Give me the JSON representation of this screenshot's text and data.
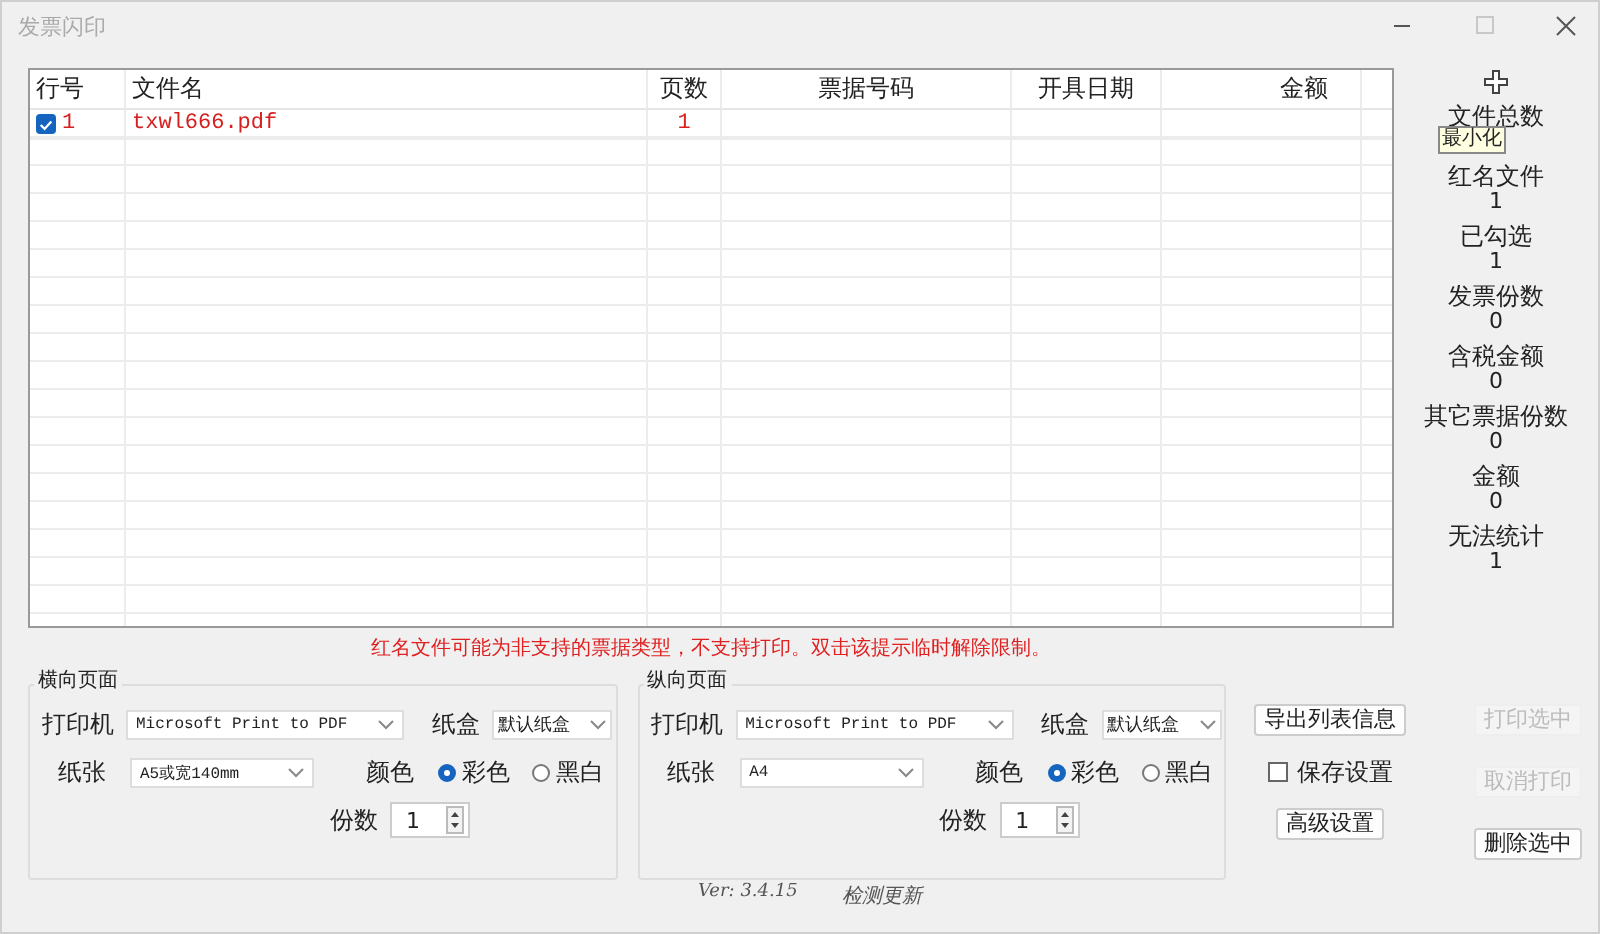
{
  "window": {
    "title": "发票闪印",
    "controls": [
      {
        "kind": "minimize",
        "disabled": false
      },
      {
        "kind": "maximize",
        "disabled": true
      },
      {
        "kind": "close",
        "disabled": false
      }
    ]
  },
  "table": {
    "columns": [
      {
        "label": "行号"
      },
      {
        "label": "文件名"
      },
      {
        "label": "页数"
      },
      {
        "label": "票据号码"
      },
      {
        "label": "开具日期"
      },
      {
        "label": "金额"
      }
    ],
    "rows": [
      {
        "checked": true,
        "flagged": true,
        "cells": [
          "1",
          "txwl666.pdf",
          "1",
          "",
          "",
          ""
        ]
      }
    ]
  },
  "stats": [
    {
      "label": "文件总数"
    },
    {
      "label": "红名文件",
      "value": "1"
    },
    {
      "label": "已勾选",
      "value": "1"
    },
    {
      "label": "发票份数",
      "value": "0"
    },
    {
      "label": "含税金额",
      "value": "0"
    },
    {
      "label": "其它票据份数",
      "value": "0"
    },
    {
      "label": "金额",
      "value": "0"
    },
    {
      "label": "无法统计",
      "value": "1"
    }
  ],
  "tooltip": "最小化",
  "warning": "红名文件可能为非支持的票据类型，不支持打印。双击该提示临时解除限制。",
  "panels": [
    {
      "title": "横向页面",
      "printer_label": "打印机",
      "printer": "Microsoft Print to PDF",
      "tray_label": "纸盒",
      "tray": "默认纸盒",
      "paper_label": "纸张",
      "paper": "A5或宽140mm",
      "color_label": "颜色",
      "color_options": [
        {
          "label": "彩色",
          "selected": true
        },
        {
          "label": "黑白",
          "selected": false
        }
      ],
      "copies_label": "份数",
      "copies": "1"
    },
    {
      "title": "纵向页面",
      "printer_label": "打印机",
      "printer": "Microsoft Print to PDF",
      "tray_label": "纸盒",
      "tray": "默认纸盒",
      "paper_label": "纸张",
      "paper": "A4",
      "color_label": "颜色",
      "color_options": [
        {
          "label": "彩色",
          "selected": true
        },
        {
          "label": "黑白",
          "selected": false
        }
      ],
      "copies_label": "份数",
      "copies": "1"
    }
  ],
  "actions": {
    "export": {
      "label": "导出列表信息",
      "disabled": false
    },
    "save_settings": {
      "label": "保存设置",
      "checked": false
    },
    "advanced": {
      "label": "高级设置",
      "disabled": false
    },
    "print_selected": {
      "label": "打印选中",
      "disabled": true
    },
    "cancel_print": {
      "label": "取消打印",
      "disabled": true
    },
    "delete_selected": {
      "label": "删除选中",
      "disabled": false
    }
  },
  "footer": {
    "version": "Ver: 3.4.15",
    "update_link": "检测更新"
  }
}
